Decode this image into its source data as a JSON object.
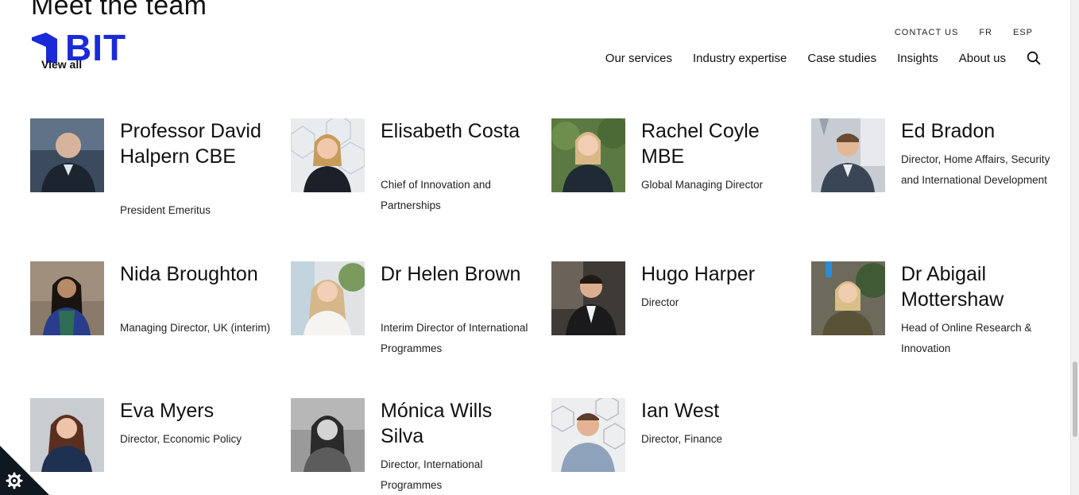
{
  "section": {
    "title": "Meet the team",
    "view_all": "View all"
  },
  "brand": {
    "logo_text": "BIT",
    "color": "#1a2ad8"
  },
  "header": {
    "utility": [
      {
        "label": "CONTACT US"
      },
      {
        "label": "FR"
      },
      {
        "label": "ESP"
      }
    ],
    "nav": [
      {
        "label": "Our services"
      },
      {
        "label": "Industry expertise"
      },
      {
        "label": "Case studies"
      },
      {
        "label": "Insights"
      },
      {
        "label": "About us"
      }
    ],
    "search_icon": "search-icon"
  },
  "team": [
    {
      "name": "Professor David Halpern CBE",
      "role": "President Emeritus"
    },
    {
      "name": "Elisabeth Costa",
      "role": "Chief of Innovation and Partnerships"
    },
    {
      "name": "Rachel Coyle MBE",
      "role": "Global Managing Director"
    },
    {
      "name": "Ed Bradon",
      "role": "Director, Home Affairs, Security and International Development"
    },
    {
      "name": "Nida Broughton",
      "role": "Managing Director, UK (interim)"
    },
    {
      "name": "Dr Helen Brown",
      "role": "Interim Director of International Programmes"
    },
    {
      "name": "Hugo Harper",
      "role": "Director"
    },
    {
      "name": "Dr Abigail Mottershaw",
      "role": "Head of Online Research & Innovation"
    },
    {
      "name": "Eva Myers",
      "role": "Director, Economic Policy"
    },
    {
      "name": "Mónica Wills Silva",
      "role": "Director, International Programmes"
    },
    {
      "name": "Ian West",
      "role": "Director, Finance"
    }
  ],
  "cookie": {
    "icon": "gear-icon"
  }
}
